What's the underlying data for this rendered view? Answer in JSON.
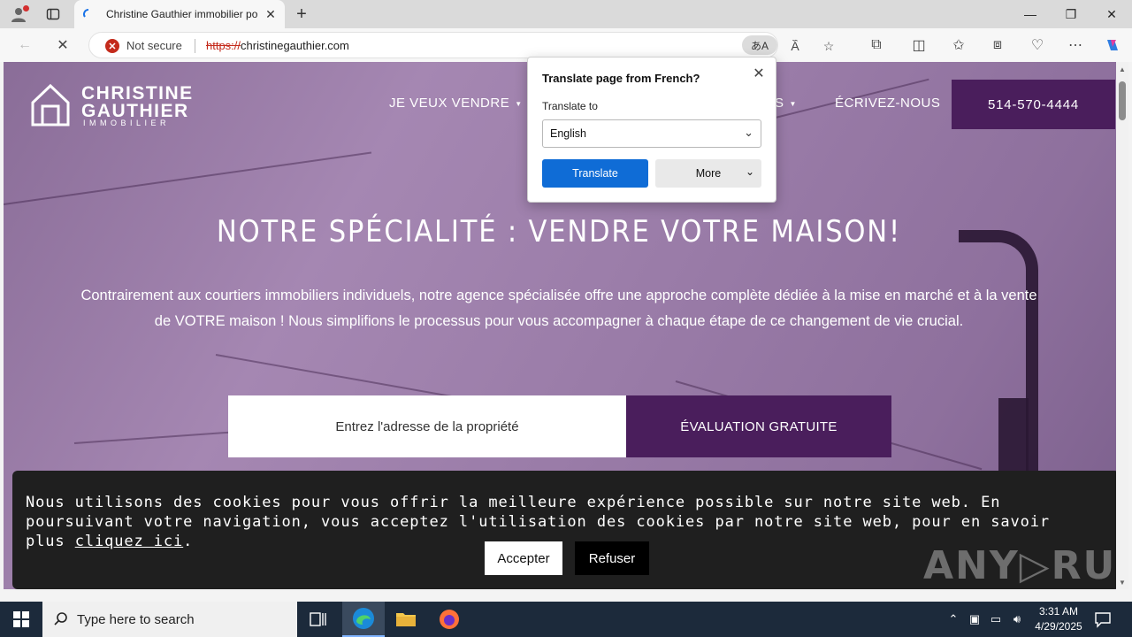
{
  "browser": {
    "tab_title": "Christine Gauthier immobilier po",
    "new_tab_label": "+",
    "security_label": "Not secure",
    "url_scheme": "https://",
    "url_host": "christinegauthier.com",
    "translate_pill": "あA"
  },
  "site": {
    "logo": {
      "line1": "CHRISTINE",
      "line2": "GAUTHIER",
      "line3": "IMMOBILIER"
    },
    "nav": [
      {
        "label": "JE VEUX VENDRE",
        "dropdown": true
      },
      {
        "label": "S",
        "dropdown": true
      },
      {
        "label": "ÉCRIVEZ-NOUS",
        "dropdown": false
      }
    ],
    "phone": "514-570-4444",
    "hero_title": "NOTRE SPÉCIALITÉ : VENDRE VOTRE MAISON!",
    "hero_text_line1": "Contrairement aux courtiers immobiliers individuels, notre agence spécialisée offre une approche complète dédiée à la mise en marché et à la vente",
    "hero_text_line2": "de VOTRE maison ! Nous simplifions le processus pour vous accompagner à chaque étape de ce changement de vie crucial.",
    "address_placeholder": "Entrez l'adresse de la propriété",
    "evaluation_button": "ÉVALUATION GRATUITE",
    "brand_color": "#4a1e5c"
  },
  "cookie_banner": {
    "text_part1": "Nous utilisons des cookies pour vous offrir la meilleure expérience possible sur notre site web. En poursuivant votre navigation, vous acceptez l'utilisation des cookies par notre site web, pour en savoir plus ",
    "link_text": "cliquez ici",
    "text_end": ".",
    "accept_label": "Accepter",
    "refuse_label": "Refuser"
  },
  "watermark": "ANY▷RUN",
  "translate_popup": {
    "title": "Translate page from French?",
    "translate_to_label": "Translate to",
    "selected_language": "English",
    "translate_button": "Translate",
    "more_button": "More"
  },
  "taskbar": {
    "search_placeholder": "Type here to search",
    "time": "3:31 AM",
    "date": "4/29/2025"
  }
}
